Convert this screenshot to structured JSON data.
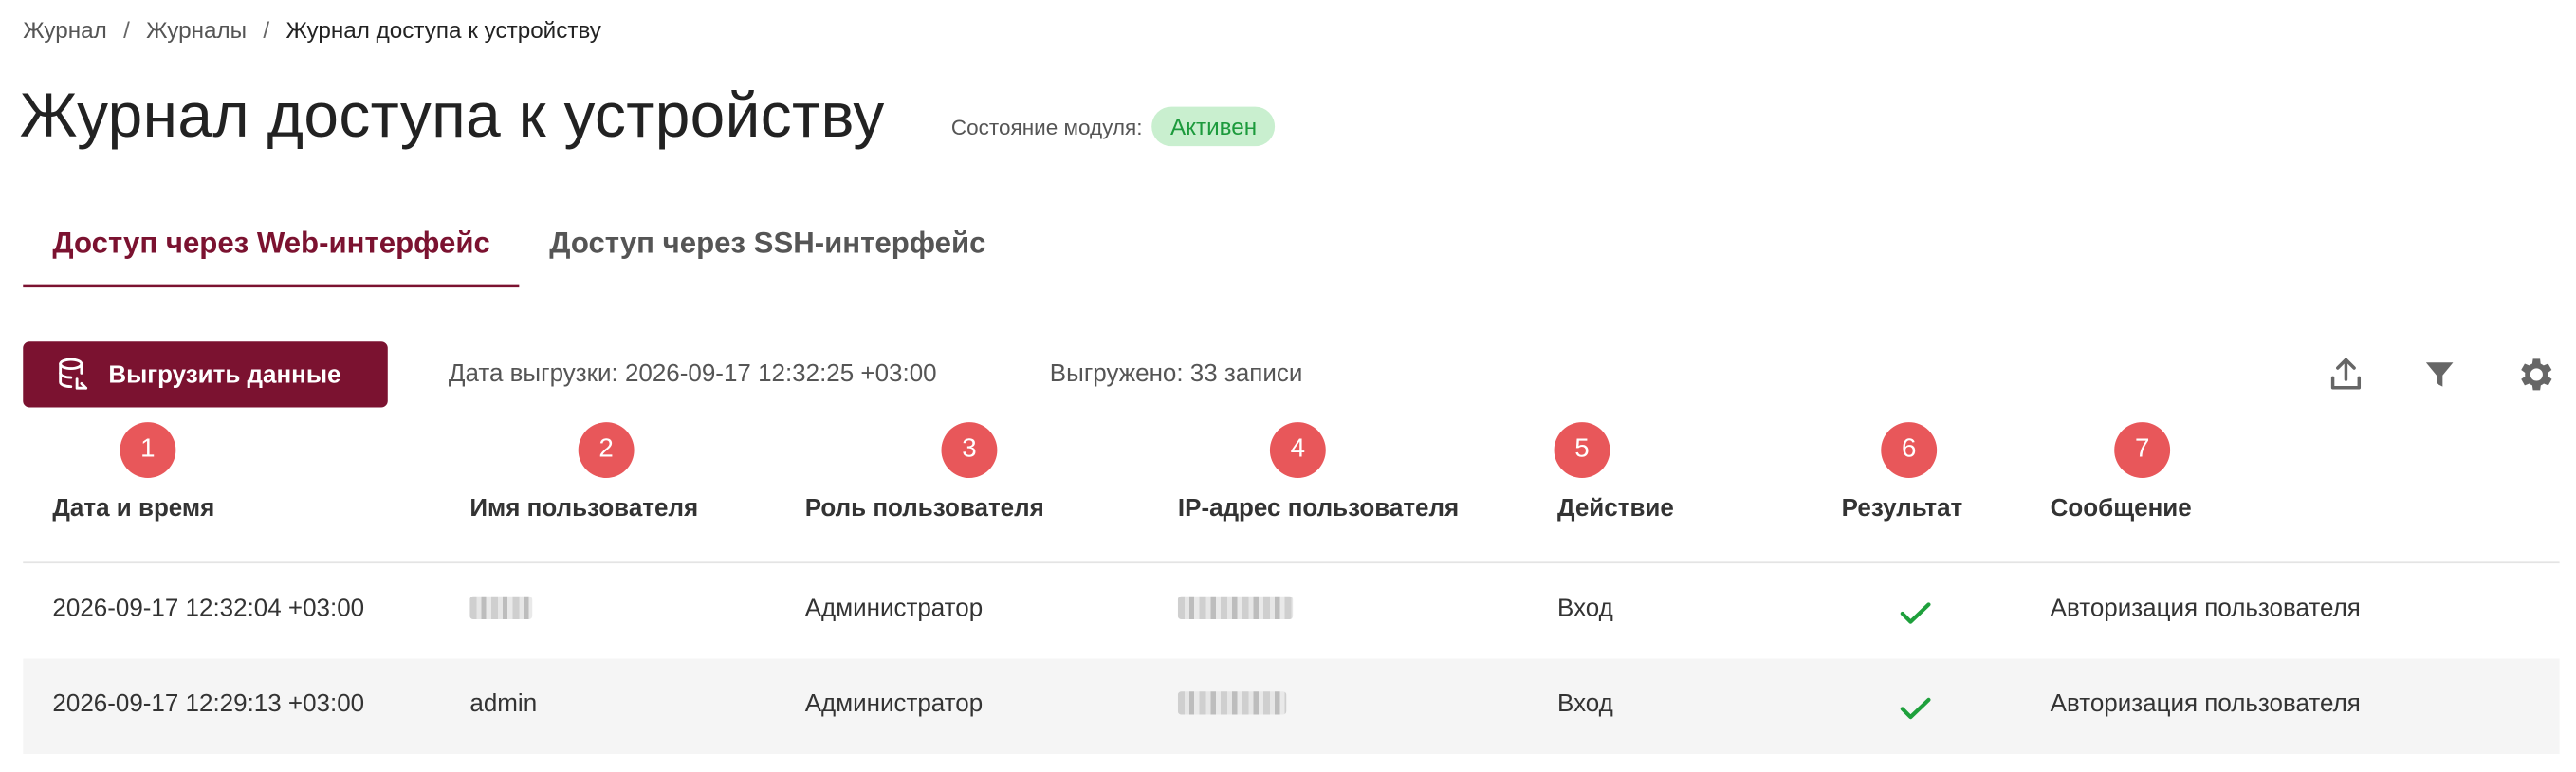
{
  "breadcrumb": {
    "items": [
      "Журнал",
      "Журналы"
    ],
    "separator": "/",
    "current": "Журнал доступа к устройству"
  },
  "page": {
    "title": "Журнал доступа к устройству",
    "status_label": "Состояние модуля:",
    "status_value": "Активен"
  },
  "tabs": [
    {
      "label": "Доступ через Web-интерфейс",
      "active": true
    },
    {
      "label": "Доступ через SSH-интерфейс",
      "active": false
    }
  ],
  "toolbar": {
    "export_label": "Выгрузить данные",
    "export_icon": "database-export-icon",
    "export_date": "Дата выгрузки: 2026-09-17 12:32:25 +03:00",
    "export_count": "Выгружено: 33 записи",
    "icons": [
      "upload-icon",
      "filter-icon",
      "gear-icon"
    ]
  },
  "markers": [
    "1",
    "2",
    "3",
    "4",
    "5",
    "6",
    "7"
  ],
  "table": {
    "columns": [
      "Дата и время",
      "Имя пользователя",
      "Роль пользователя",
      "IP-адрес пользователя",
      "Действие",
      "Результат",
      "Сообщение"
    ],
    "rows": [
      {
        "datetime": "2026-09-17 12:32:04 +03:00",
        "user": "",
        "user_redacted": true,
        "role": "Администратор",
        "ip_redacted": true,
        "action": "Вход",
        "result": "success-check-icon",
        "message": "Авторизация пользователя"
      },
      {
        "datetime": "2026-09-17 12:29:13 +03:00",
        "user": "admin",
        "user_redacted": false,
        "role": "Администратор",
        "ip_redacted": true,
        "action": "Вход",
        "result": "success-check-icon",
        "message": "Авторизация пользователя"
      }
    ]
  },
  "colors": {
    "accent": "#7b1230",
    "badge_bg": "#c9efcf",
    "badge_text": "#1c9a3c",
    "marker": "#e8575a",
    "check": "#1ea03c"
  }
}
